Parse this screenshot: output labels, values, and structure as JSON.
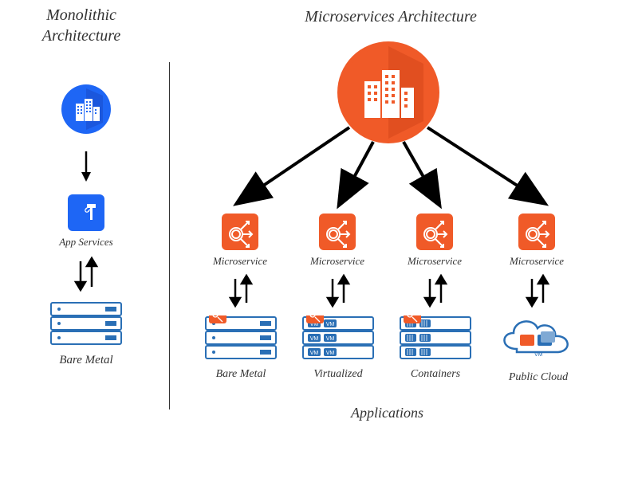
{
  "left": {
    "title": "Monolithic\nArchitecture",
    "appServices": "App Services",
    "bareMetal": "Bare Metal"
  },
  "right": {
    "title": "Microservices Architecture",
    "microservice": "Microservice",
    "deployments": [
      "Bare Metal",
      "Virtualized",
      "Containers",
      "Public Cloud"
    ],
    "footer": "Applications"
  }
}
